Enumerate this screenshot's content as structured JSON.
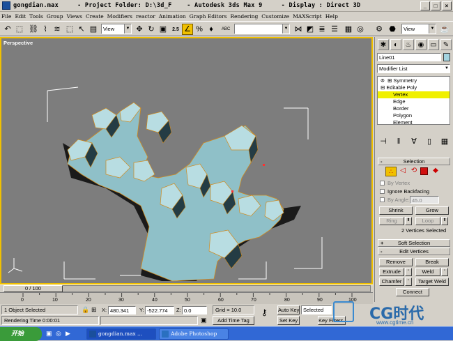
{
  "window": {
    "title": "gongdian.max     - Project Folder: D:\\3d_F    - Autodesk 3ds Max 9     - Display : Direct 3D",
    "min_label": "_",
    "max_label": "□",
    "close_label": "×"
  },
  "menu": [
    "File",
    "Edit",
    "Tools",
    "Group",
    "Views",
    "Create",
    "Modifiers",
    "reactor",
    "Animation",
    "Graph Editors",
    "Rendering",
    "Customize",
    "MAXScript",
    "Help"
  ],
  "toolbar": {
    "ref_coord": "View",
    "selection_set": "",
    "view2": "View",
    "snap_label": "2.5",
    "abc_label": "ABC"
  },
  "viewport": {
    "label": "Perspective"
  },
  "command_panel": {
    "object_name": "Line01",
    "modifier_list": "Modifier List",
    "stack": [
      "Symmetry",
      "Editable Poly",
      "Vertex",
      "Edge",
      "Border",
      "Polygon",
      "Element"
    ],
    "selection": {
      "title": "Selection",
      "by_vertex": "By Vertex",
      "ignore_backfacing": "Ignore Backfacing",
      "by_angle": "By Angle:",
      "angle_value": "45.0",
      "shrink": "Shrink",
      "grow": "Grow",
      "ring": "Ring",
      "loop": "Loop",
      "status": "2 Vertices Selected"
    },
    "soft_selection": "Soft Selection",
    "edit_vertices": {
      "title": "Edit Vertices",
      "remove": "Remove",
      "break": "Break",
      "extrude": "Extrude",
      "weld": "Weld",
      "chamfer": "Chamfer",
      "target_weld": "Target Weld",
      "connect": "Connect"
    }
  },
  "timeline": {
    "slider": "0 / 100",
    "ticks": [
      "0",
      "10",
      "20",
      "30",
      "40",
      "50",
      "60",
      "70",
      "80",
      "90",
      "100"
    ]
  },
  "status": {
    "selected": "1 Object Selected",
    "rendering": "Rendering Time  0:00:01",
    "x_label": "X:",
    "x_value": "480.341",
    "y_label": "Y:",
    "y_value": "-522.774",
    "z_label": "Z:",
    "z_value": "0.0",
    "grid": "Grid = 10.0",
    "add_time_tag": "Add Time Tag",
    "auto_key": "Auto Key",
    "selected_mode": "Selected",
    "set_key": "Set Key",
    "key_filters": "Key Filters..."
  },
  "taskbar": {
    "start": "开始",
    "tasks": [
      "gongdian.max ...",
      "Adobe Photoshop"
    ]
  },
  "watermark": {
    "logo": "CG时代",
    "url": "www.cgtime.cn"
  },
  "colors": {
    "active_border": "#f0c000",
    "mesh_fill": "#8fc0c8",
    "viewport_bg": "#7d7d7d",
    "taskbar": "#3168d5"
  }
}
